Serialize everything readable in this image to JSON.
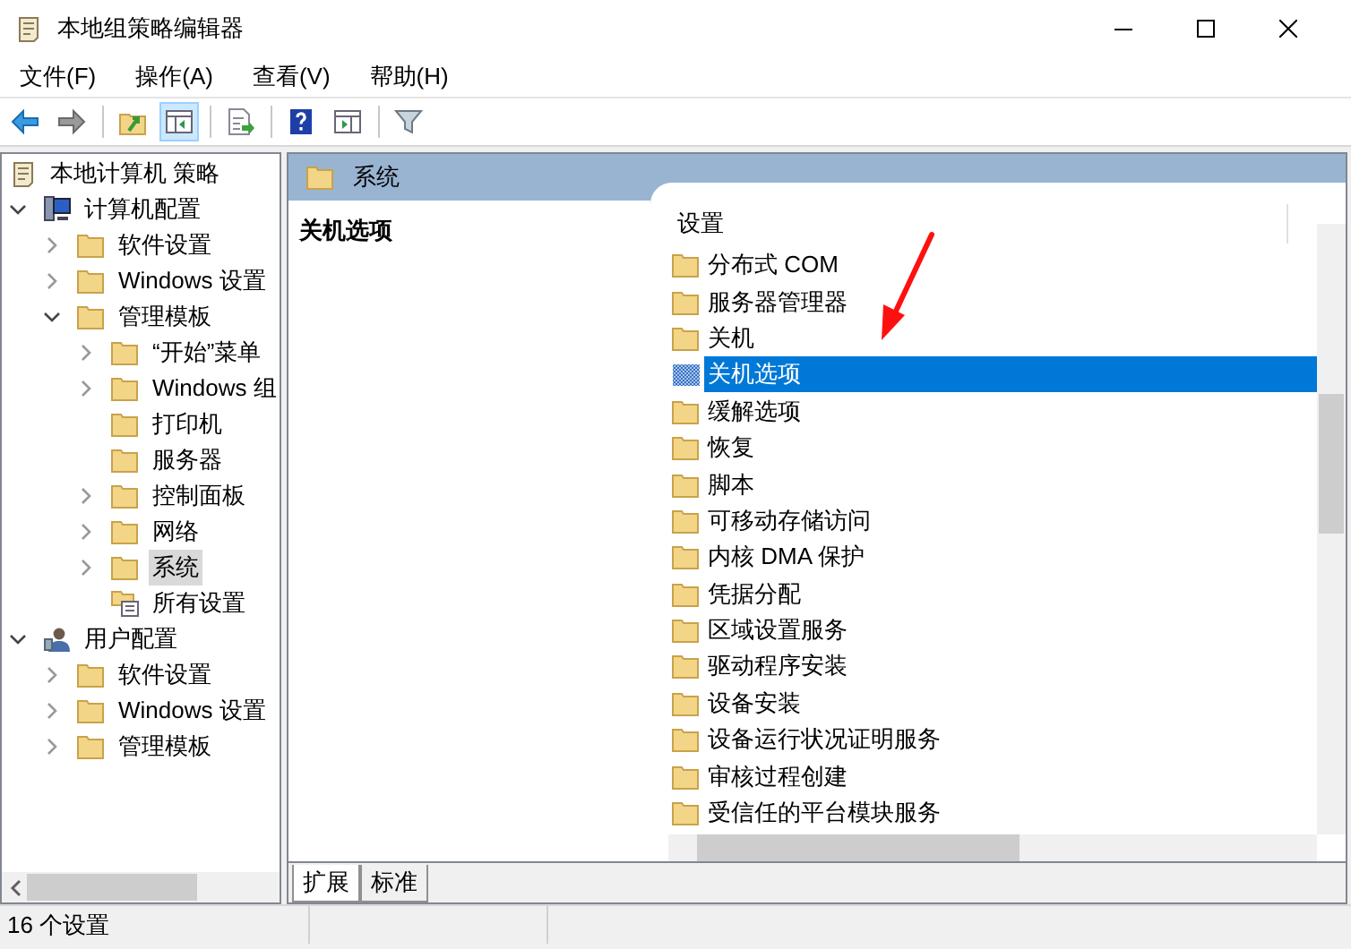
{
  "window": {
    "title": "本地组策略编辑器"
  },
  "menu": [
    "文件(F)",
    "操作(A)",
    "查看(V)",
    "帮助(H)"
  ],
  "toolbar": [
    {
      "kind": "back",
      "pressed": false
    },
    {
      "kind": "forward",
      "pressed": false
    },
    {
      "kind": "sep"
    },
    {
      "kind": "up",
      "pressed": false
    },
    {
      "kind": "tree",
      "pressed": true
    },
    {
      "kind": "sep"
    },
    {
      "kind": "export",
      "pressed": false
    },
    {
      "kind": "sep"
    },
    {
      "kind": "help",
      "pressed": false
    },
    {
      "kind": "pane",
      "pressed": false
    },
    {
      "kind": "sep"
    },
    {
      "kind": "filter",
      "pressed": false
    }
  ],
  "tree": [
    {
      "label": "本地计算机 策略",
      "kind": "policy",
      "selected": false,
      "children": [
        {
          "label": "计算机配置",
          "kind": "computer",
          "expanded": true,
          "selected": false,
          "children": [
            {
              "label": "软件设置",
              "kind": "folder",
              "expanded": false,
              "selected": false
            },
            {
              "label": "Windows 设置",
              "kind": "folder",
              "expanded": false,
              "selected": false
            },
            {
              "label": "管理模板",
              "kind": "folder",
              "expanded": true,
              "selected": false,
              "children": [
                {
                  "label": "“开始”菜单",
                  "kind": "folder",
                  "expanded": false,
                  "selected": false
                },
                {
                  "label": "Windows 组",
                  "kind": "folder",
                  "expanded": false,
                  "selected": false
                },
                {
                  "label": "打印机",
                  "kind": "folder",
                  "selected": false
                },
                {
                  "label": "服务器",
                  "kind": "folder",
                  "selected": false
                },
                {
                  "label": "控制面板",
                  "kind": "folder",
                  "expanded": false,
                  "selected": false
                },
                {
                  "label": "网络",
                  "kind": "folder",
                  "expanded": false,
                  "selected": false
                },
                {
                  "label": "系统",
                  "kind": "folder",
                  "expanded": false,
                  "selected": true
                },
                {
                  "label": "所有设置",
                  "kind": "settings",
                  "selected": false
                }
              ]
            }
          ]
        },
        {
          "label": "用户配置",
          "kind": "user",
          "expanded": true,
          "selected": false,
          "children": [
            {
              "label": "软件设置",
              "kind": "folder",
              "expanded": false,
              "selected": false
            },
            {
              "label": "Windows 设置",
              "kind": "folder",
              "expanded": false,
              "selected": false
            },
            {
              "label": "管理模板",
              "kind": "folder",
              "expanded": false,
              "selected": false
            }
          ]
        }
      ]
    }
  ],
  "header": {
    "title": "系统"
  },
  "description": {
    "title": "关机选项"
  },
  "list": {
    "column": "设置",
    "items": [
      {
        "label": "分布式 COM",
        "selected": false
      },
      {
        "label": "服务器管理器",
        "selected": false
      },
      {
        "label": "关机",
        "selected": false
      },
      {
        "label": "关机选项",
        "selected": true
      },
      {
        "label": "缓解选项",
        "selected": false
      },
      {
        "label": "恢复",
        "selected": false
      },
      {
        "label": "脚本",
        "selected": false
      },
      {
        "label": "可移动存储访问",
        "selected": false
      },
      {
        "label": "内核 DMA 保护",
        "selected": false
      },
      {
        "label": "凭据分配",
        "selected": false
      },
      {
        "label": "区域设置服务",
        "selected": false
      },
      {
        "label": "驱动程序安装",
        "selected": false
      },
      {
        "label": "设备安装",
        "selected": false
      },
      {
        "label": "设备运行状况证明服务",
        "selected": false
      },
      {
        "label": "审核过程创建",
        "selected": false
      },
      {
        "label": "受信任的平台模块服务",
        "selected": false
      }
    ]
  },
  "tabs": [
    {
      "label": "扩展",
      "selected": true
    },
    {
      "label": "标准",
      "selected": false
    }
  ],
  "status_bar": "16 个设置"
}
